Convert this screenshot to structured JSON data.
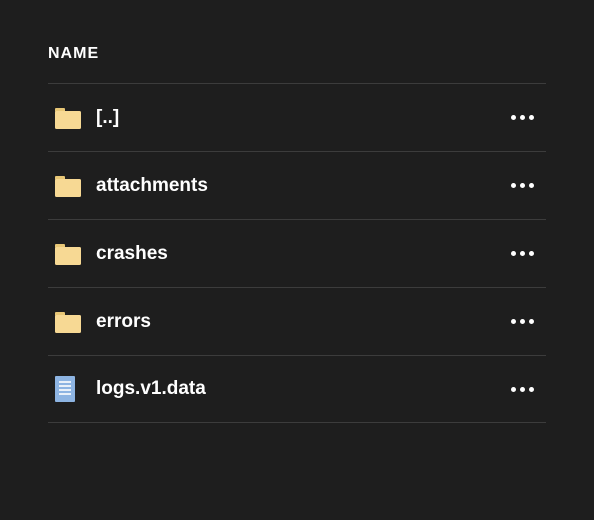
{
  "header": {
    "name_label": "NAME"
  },
  "icon_colors": {
    "folder_fill": "#f7d994",
    "folder_tab": "#e8c776",
    "file_fill": "#8db4e2",
    "file_line": "#ffffff"
  },
  "items": [
    {
      "type": "folder",
      "name": "[..]"
    },
    {
      "type": "folder",
      "name": "attachments"
    },
    {
      "type": "folder",
      "name": "crashes"
    },
    {
      "type": "folder",
      "name": "errors"
    },
    {
      "type": "file",
      "name": "logs.v1.data"
    }
  ]
}
